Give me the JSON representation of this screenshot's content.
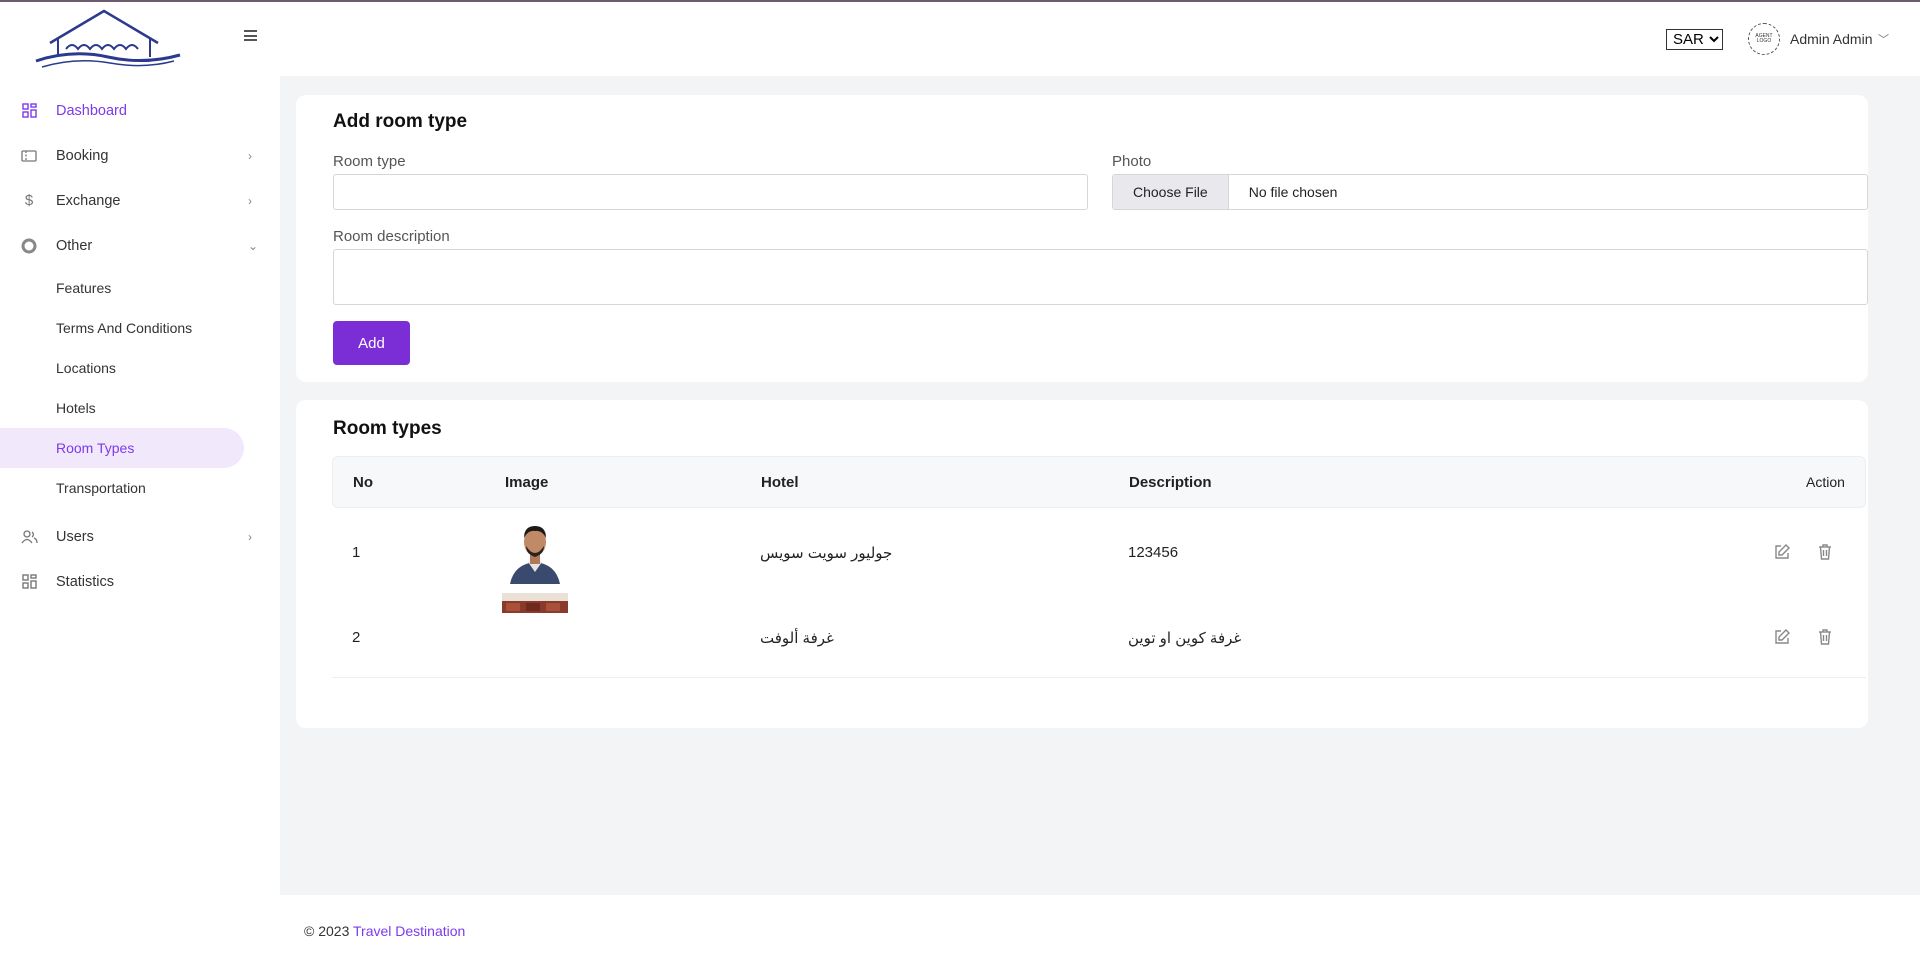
{
  "header": {
    "currency": "SAR",
    "currency_options": [
      "SAR"
    ],
    "avatar_text": "AGENT LOGO",
    "user_name": "Admin Admin"
  },
  "sidebar": {
    "items": [
      {
        "label": "Dashboard",
        "icon": "dashboard-icon"
      },
      {
        "label": "Booking",
        "icon": "ticket-icon"
      },
      {
        "label": "Exchange",
        "icon": "dollar-icon"
      },
      {
        "label": "Other",
        "icon": "circle-icon"
      }
    ],
    "sub_items": [
      "Features",
      "Terms And Conditions",
      "Locations",
      "Hotels",
      "Room Types",
      "Transportation"
    ],
    "bottom_items": [
      {
        "label": "Users",
        "icon": "users-icon"
      },
      {
        "label": "Statistics",
        "icon": "dashboard-icon"
      }
    ],
    "active_color": "#7c3aed"
  },
  "add_form": {
    "title": "Add room type",
    "room_type_label": "Room type",
    "room_type_value": "",
    "photo_label": "Photo",
    "file_button": "Choose File",
    "file_status": "No file chosen",
    "description_label": "Room description",
    "description_value": "",
    "submit_label": "Add",
    "button_color": "#7c2ed6"
  },
  "list": {
    "title": "Room types",
    "columns": [
      "No",
      "Image",
      "Hotel",
      "Description",
      "Action"
    ],
    "rows": [
      {
        "no": "1",
        "hotel": "جوليور سويت سويس",
        "description": "123456"
      },
      {
        "no": "2",
        "hotel": "غرفة ألوفت",
        "description": "غرفة كوين او توين"
      }
    ]
  },
  "footer": {
    "prefix": "© 2023",
    "link": "Travel Destination"
  }
}
